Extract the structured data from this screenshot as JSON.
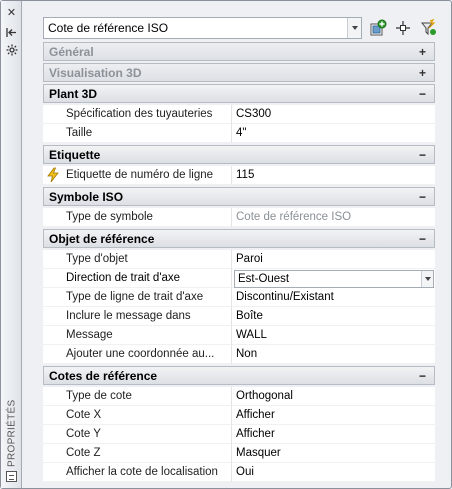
{
  "panel": {
    "title": "PROPRIÉTÉS"
  },
  "selector": {
    "value": "Cote de référence ISO"
  },
  "sections": {
    "general": {
      "title": "Général",
      "toggle": "+"
    },
    "vis3d": {
      "title": "Visualisation 3D",
      "toggle": "+"
    },
    "plant3d": {
      "title": "Plant 3D",
      "toggle": "−",
      "rows": [
        {
          "label": "Spécification des tuyauteries",
          "value": "CS300"
        },
        {
          "label": "Taille",
          "value": "4\""
        }
      ]
    },
    "etiquette": {
      "title": "Etiquette",
      "toggle": "−",
      "rows": [
        {
          "label": "Etiquette de numéro de ligne",
          "value": "115"
        }
      ]
    },
    "symbole": {
      "title": "Symbole ISO",
      "toggle": "−",
      "rows": [
        {
          "label": "Type de symbole",
          "value": "Cote de référence ISO"
        }
      ]
    },
    "objet": {
      "title": "Objet de référence",
      "toggle": "−",
      "rows": [
        {
          "label": "Type d'objet",
          "value": "Paroi"
        },
        {
          "label": "Direction de trait d'axe",
          "value": "Est-Ouest"
        },
        {
          "label": "Type de ligne de trait d'axe",
          "value": "Discontinu/Existant"
        },
        {
          "label": "Inclure le message dans",
          "value": "Boîte"
        },
        {
          "label": "Message",
          "value": "WALL"
        },
        {
          "label": "Ajouter une coordonnée au...",
          "value": "Non"
        }
      ]
    },
    "cotes": {
      "title": "Cotes de référence",
      "toggle": "−",
      "rows": [
        {
          "label": "Type de cote",
          "value": "Orthogonal"
        },
        {
          "label": "Cote X",
          "value": "Afficher"
        },
        {
          "label": "Cote Y",
          "value": "Afficher"
        },
        {
          "label": "Cote Z",
          "value": "Masquer"
        },
        {
          "label": "Afficher la cote de localisation",
          "value": "Oui"
        }
      ]
    }
  },
  "colors": {
    "accent": "#2a7a2a",
    "bolt": "#f0c020",
    "muted_text": "#8a8f96"
  }
}
